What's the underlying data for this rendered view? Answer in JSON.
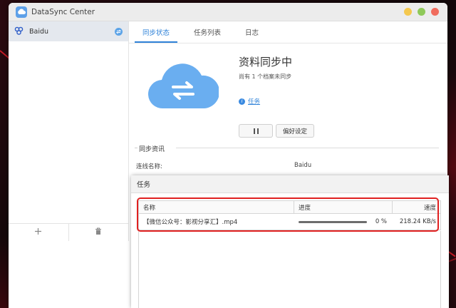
{
  "window": {
    "title": "DataSync Center"
  },
  "sidebar": {
    "connections": [
      {
        "name": "Baidu"
      }
    ],
    "footer": {
      "add_icon": "plus-icon",
      "delete_icon": "trash-icon"
    }
  },
  "tabs": [
    {
      "label": "同步状态"
    },
    {
      "label": "任务列表"
    },
    {
      "label": "日志"
    }
  ],
  "status": {
    "title": "资料同步中",
    "subtitle": "尚有 1 个档案未同步",
    "task_link": "任务",
    "pause_label": "❚❚",
    "prefs_button": "偏好设定"
  },
  "sync_info": {
    "section_title": "同步资讯",
    "connection_label": "连线名称:",
    "connection_value": "Baidu"
  },
  "task_dialog": {
    "title": "任务",
    "columns": {
      "name": "名称",
      "progress": "进度",
      "speed": "速度"
    },
    "rows": [
      {
        "name": "【微信公众号：影视分享汇】.mp4",
        "progress": 0,
        "progress_text": "0 %",
        "speed": "218.24 KB/s"
      }
    ]
  },
  "colors": {
    "accent": "#2f82d8",
    "highlight": "#e02020",
    "cloud": "#6aaef0"
  }
}
